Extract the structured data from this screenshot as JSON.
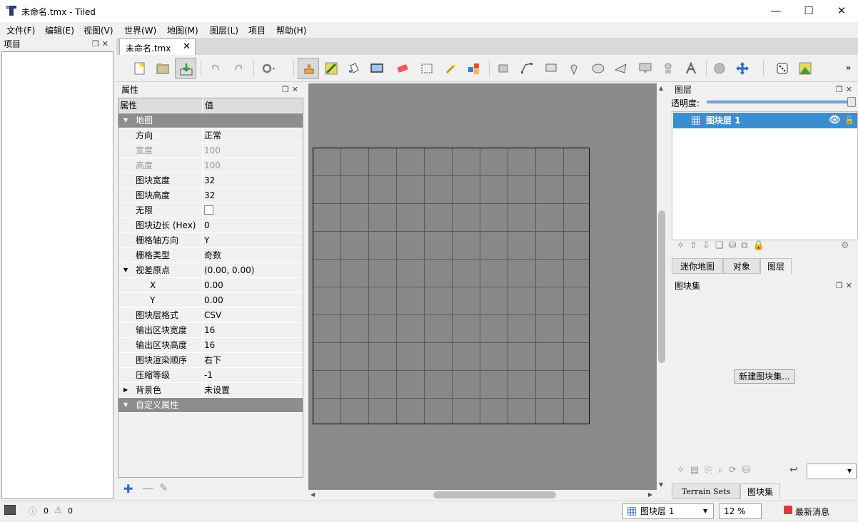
{
  "window": {
    "title": "未命名.tmx - Tiled",
    "minimize": "—",
    "maximize": "☐",
    "close": "✕"
  },
  "menu": [
    "文件(F)",
    "编辑(E)",
    "视图(V)",
    "世界(W)",
    "地图(M)",
    "图层(L)",
    "项目",
    "帮助(H)"
  ],
  "project_panel": {
    "title": "项目"
  },
  "document_tab": {
    "label": "未命名.tmx",
    "close": "✕"
  },
  "properties_panel": {
    "title": "属性",
    "header": {
      "key": "属性",
      "value": "值"
    },
    "group_map": "地图",
    "rows": [
      {
        "key": "方向",
        "value": "正常"
      },
      {
        "key": "宽度",
        "value": "100"
      },
      {
        "key": "高度",
        "value": "100"
      },
      {
        "key": "图块宽度",
        "value": "32"
      },
      {
        "key": "图块高度",
        "value": "32"
      },
      {
        "key": "无限",
        "value": ""
      },
      {
        "key": "图块边长 (Hex)",
        "value": "0"
      },
      {
        "key": "栅格轴方向",
        "value": "Y"
      },
      {
        "key": "栅格类型",
        "value": "奇数"
      },
      {
        "key": "视差原点",
        "value": "(0.00, 0.00)"
      },
      {
        "key": "X",
        "value": "0.00"
      },
      {
        "key": "Y",
        "value": "0.00"
      },
      {
        "key": "图块层格式",
        "value": "CSV"
      },
      {
        "key": "输出区块宽度",
        "value": "16"
      },
      {
        "key": "输出区块高度",
        "value": "16"
      },
      {
        "key": "图块渲染顺序",
        "value": "右下"
      },
      {
        "key": "压缩等级",
        "value": "-1"
      },
      {
        "key": "背景色",
        "value": "未设置"
      }
    ],
    "group_custom": "自定义属性"
  },
  "layers_panel": {
    "title": "图层",
    "opacity_label": "透明度:",
    "opacity": 1.0,
    "layer_name": "图块层 1",
    "tabs": [
      "迷你地图",
      "对象",
      "图层"
    ]
  },
  "tileset_panel": {
    "title": "图块集",
    "new_button": "新建图块集...",
    "tabs": [
      "Terrain Sets",
      "图块集"
    ]
  },
  "status": {
    "errors": "0",
    "warnings": "0",
    "layer_combo": "图块层 1",
    "zoom": "12 %",
    "news": "最新消息"
  },
  "colors": {
    "selection": "#3b8fd0",
    "canvas": "#8a8a8a"
  }
}
